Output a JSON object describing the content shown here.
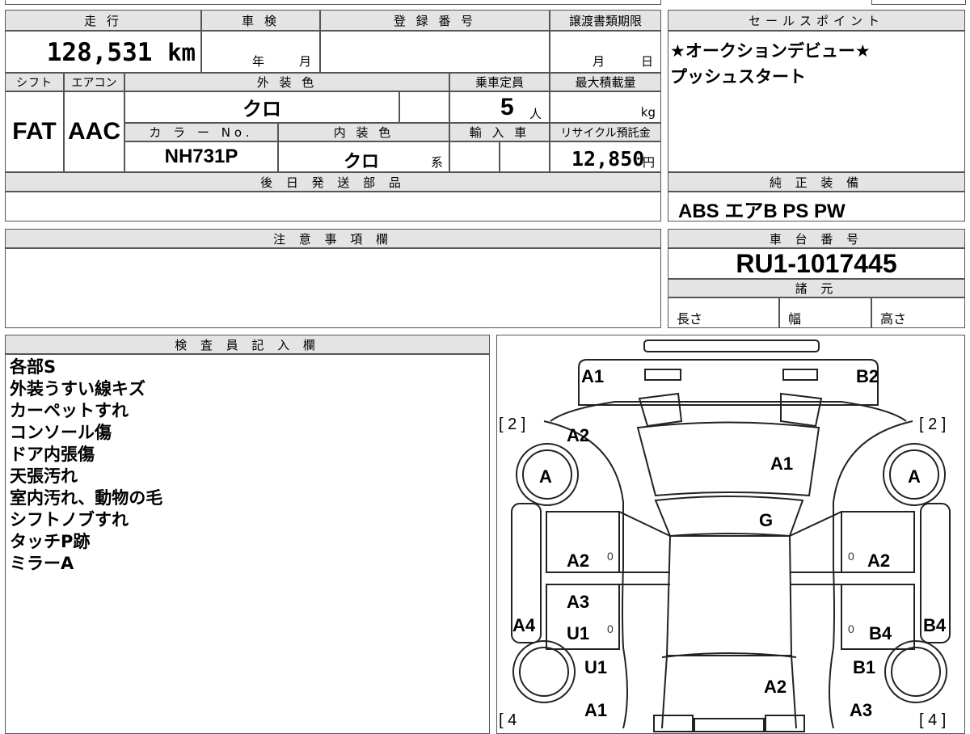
{
  "top_info": {
    "mileage_label": "走 行",
    "mileage_value": "128,531",
    "mileage_unit": "km",
    "inspection_label": "車 検",
    "inspection_year": "年",
    "inspection_month": "月",
    "registration_label": "登 録 番 号",
    "transfer_label": "譲渡書類期限",
    "transfer_month": "月",
    "transfer_day": "日",
    "shift_label": "シフト",
    "shift_value": "FAT",
    "ac_label": "エアコン",
    "ac_value": "AAC",
    "exterior_label": "外 装 色",
    "exterior_value": "クロ",
    "capacity_label": "乗車定員",
    "capacity_value": "5",
    "capacity_unit": "人",
    "maxload_label": "最大積載量",
    "maxload_unit": "kg",
    "colorno_label": "カ ラ ー No.",
    "colorno_value": "NH731P",
    "interior_label": "内 装 色",
    "interior_value": "クロ",
    "interior_suffix": "系",
    "import_label": "輸 入 車",
    "recycle_label": "リサイクル預託金",
    "recycle_value": "12,850",
    "recycle_unit": "円",
    "later_parts_label": "後 日 発 送 部 品"
  },
  "sales_point": {
    "label": "セールスポイント",
    "line1": "★オークションデビュー★",
    "line2": "プッシュスタート"
  },
  "genuine_equipment": {
    "label": "純 正 装 備",
    "value": "ABS エアB PS PW"
  },
  "notes": {
    "label": "注 意 事 項 欄"
  },
  "chassis": {
    "label": "車 台 番 号",
    "value": "RU1-1017445",
    "specs_label": "諸 元",
    "length_label": "長さ",
    "width_label": "幅",
    "height_label": "高さ"
  },
  "inspector": {
    "label": "検 査 員 記 入 欄",
    "remarks": [
      "各部S",
      "外装うすい線キズ",
      "カーペットすれ",
      "コンソール傷",
      "ドア内張傷",
      "天張汚れ",
      "室内汚れ、動物の毛",
      "シフトノブすれ",
      "タッチP跡",
      "ミラーA"
    ]
  },
  "diagram": {
    "marks": {
      "front_bumper_left": "A1",
      "front_bumper_right": "B2",
      "front_fender_left": "A2",
      "hood": "A1",
      "windshield": "G",
      "front_door_left": "A2",
      "front_door_right": "A2",
      "rear_door_left_a": "A3",
      "rear_door_left_b": "U1",
      "rear_door_right": "B4",
      "rocker_left": "A4",
      "rocker_right": "B4",
      "rear_fender_left": "U1",
      "rear_fender_right": "B1",
      "tailgate": "A2",
      "rear_bumper_left": "A1",
      "rear_bumper_right": "A3",
      "front_wheel_left": "A",
      "front_wheel_right": "A",
      "tire_front_left": "[ 2 ]",
      "tire_front_right": "[ 2 ]",
      "tire_rear_left": "[ 4",
      "tire_rear_right": "[ 4 ]",
      "zero": "0"
    }
  }
}
